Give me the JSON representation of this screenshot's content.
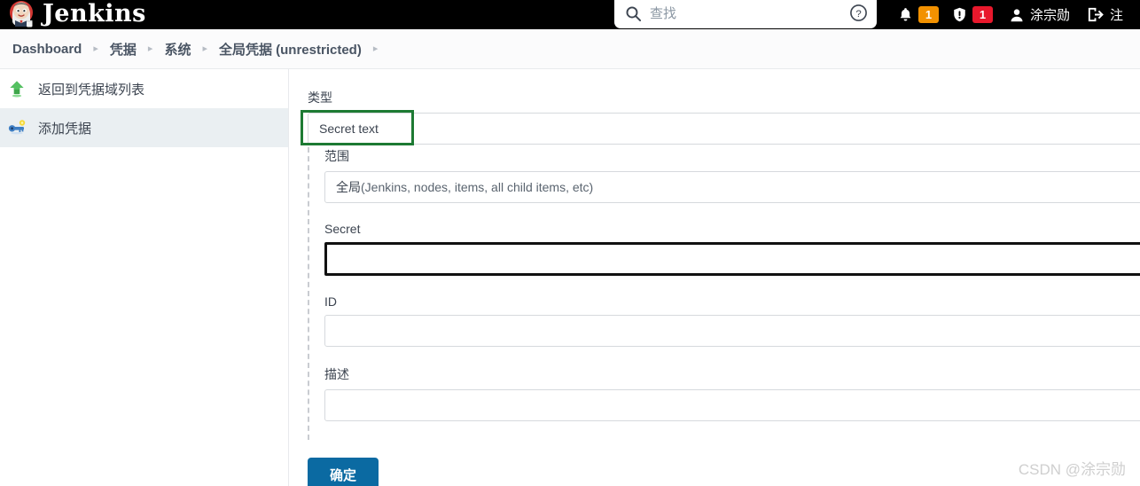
{
  "header": {
    "brand_title": "Jenkins",
    "logo_icon": "jenkins-butler-logo",
    "search": {
      "icon": "search-icon",
      "placeholder": "查找",
      "value": "",
      "help_icon": "help-circle-icon"
    },
    "notifications": {
      "bell_icon": "bell-icon",
      "bell_count": "1",
      "bell_badge_color": "#f29100",
      "security_icon": "shield-exclamation-icon",
      "security_count": "1",
      "security_badge_color": "#e8182c"
    },
    "user": {
      "avatar_icon": "person-icon",
      "name": "涂宗勋"
    },
    "logout": {
      "icon": "logout-arrow-icon",
      "label": "注"
    }
  },
  "breadcrumb": {
    "items": [
      {
        "label": "Dashboard"
      },
      {
        "label": "凭据"
      },
      {
        "label": "系统"
      },
      {
        "label": "全局凭据 (unrestricted)"
      }
    ],
    "separator": "▸"
  },
  "sidebar": {
    "items": [
      {
        "label": "返回到凭据域列表",
        "icon": "green-up-arrow-icon",
        "active": false
      },
      {
        "label": "添加凭据",
        "icon": "key-icon",
        "active": true
      }
    ]
  },
  "form": {
    "type": {
      "label": "类型",
      "value": "Secret text",
      "highlight_color": "#1d7a33"
    },
    "scope": {
      "label": "范围",
      "value_strong": "全局",
      "value_rest": " (Jenkins, nodes, items, all child items, etc)"
    },
    "secret": {
      "label": "Secret",
      "value": "",
      "highlight_color": "#111111"
    },
    "id": {
      "label": "ID",
      "value": ""
    },
    "description": {
      "label": "描述",
      "value": ""
    },
    "submit_label": "确定"
  },
  "watermark": {
    "text": "CSDN @涂宗勋"
  }
}
